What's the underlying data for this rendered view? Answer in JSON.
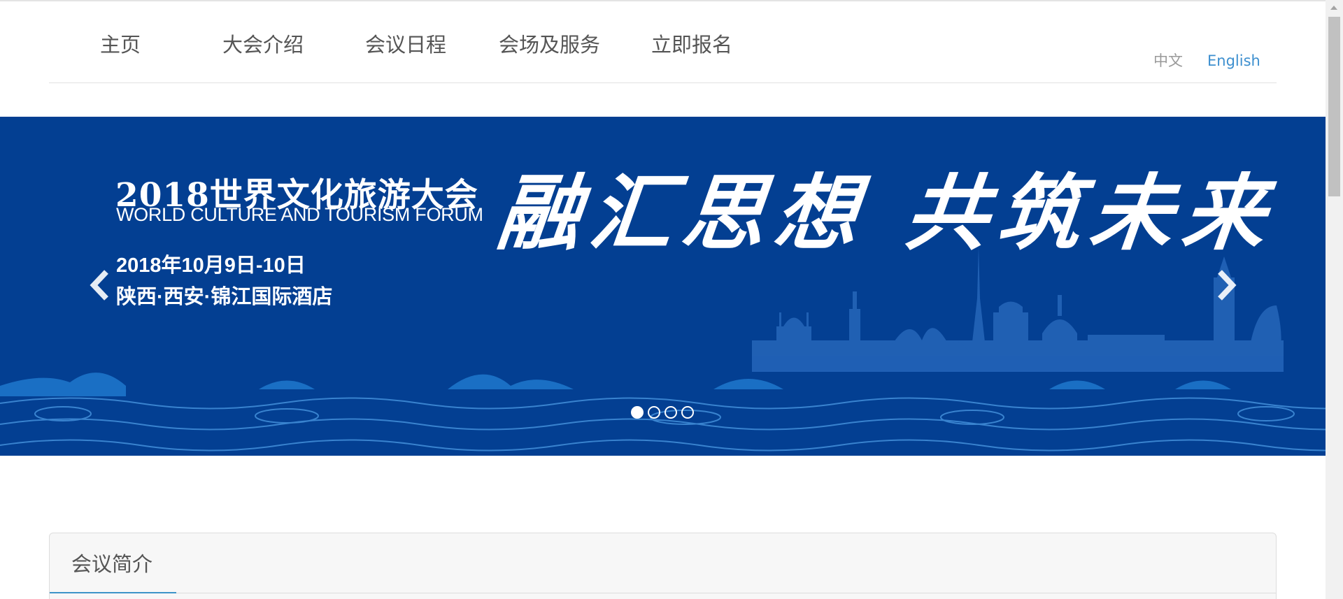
{
  "nav": {
    "items": [
      {
        "label": "主页"
      },
      {
        "label": "大会介绍"
      },
      {
        "label": "会议日程"
      },
      {
        "label": "会场及服务"
      },
      {
        "label": "立即报名"
      }
    ],
    "languages": [
      {
        "label": "中文",
        "color": "#999999"
      },
      {
        "label": "English",
        "color": "#3d8fcf"
      }
    ]
  },
  "banner": {
    "title": "2018世界文化旅游大会",
    "subtitle": "WORLD CULTURE AND TOURISM FORUM",
    "date": "2018年10月9日-10日",
    "venue": "陕西·西安·锦江国际酒店",
    "slogan": "融汇思想 共筑未来",
    "background_color": "#033f92",
    "wave_color": "#1a6fc4",
    "prev_icon": "chevron-left-icon",
    "next_icon": "chevron-right-icon",
    "slide_count": 4,
    "active_slide": 1
  },
  "intro": {
    "title": "会议简介",
    "accent_color": "#3d94c8"
  },
  "scrollbar": {
    "icon": "scroll-up-arrow-icon"
  }
}
